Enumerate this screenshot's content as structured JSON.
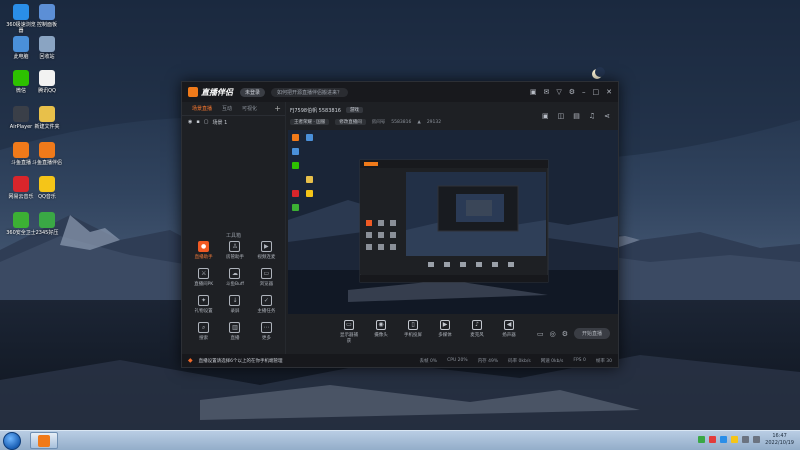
{
  "desktop": {
    "icons": [
      {
        "label": "360极速浏览器",
        "icon": "browser-360-icon",
        "color": "#2a8ee8"
      },
      {
        "label": "此电脑",
        "icon": "computer-icon",
        "color": "#4a90d9"
      },
      {
        "label": "微信",
        "icon": "wechat-icon",
        "color": "#2dc100"
      },
      {
        "label": "AirPlayer",
        "icon": "airplayer-icon",
        "color": "#3a3f48"
      },
      {
        "label": "斗鱼直播",
        "icon": "douyu-icon",
        "color": "#f07a1a"
      },
      {
        "label": "网易云音乐",
        "icon": "netease-music-icon",
        "color": "#d9252b"
      },
      {
        "label": "360安全卫士",
        "icon": "security-360-icon",
        "color": "#3cb034"
      },
      {
        "label": "控制面板",
        "icon": "control-panel-icon",
        "color": "#5c8fd6"
      },
      {
        "label": "回收站",
        "icon": "recycle-bin-icon",
        "color": "#8aa4c2"
      },
      {
        "label": "腾讯QQ",
        "icon": "qq-icon",
        "color": "#f2f2f2"
      },
      {
        "label": "新建文件夹",
        "icon": "folder-icon",
        "color": "#e8c04a"
      },
      {
        "label": "斗鱼直播伴侣",
        "icon": "douyu-companion-icon",
        "color": "#f07a1a"
      },
      {
        "label": "QQ音乐",
        "icon": "qq-music-icon",
        "color": "#f5c518"
      },
      {
        "label": "2345好压",
        "icon": "haozip-icon",
        "color": "#3aa845"
      }
    ]
  },
  "app": {
    "title": "直播伴侣",
    "login_badge": "未登录",
    "notice": "如何把开源直播伴侣搬进来？",
    "left_tabs": [
      "场景直播",
      "互动",
      "可视化"
    ],
    "scene_name": "场景 1",
    "tools_title": "工具箱",
    "tools": [
      {
        "label": "直播助手",
        "icon": "camera-icon",
        "hot": true
      },
      {
        "label": "房管助手",
        "icon": "user-icon",
        "hot": false
      },
      {
        "label": "视频连麦",
        "icon": "video-call-icon",
        "hot": false
      },
      {
        "label": "直播间PK",
        "icon": "pk-icon",
        "hot": false
      },
      {
        "label": "斗鱼Buff",
        "icon": "buff-icon",
        "hot": false
      },
      {
        "label": "浏览器",
        "icon": "browser-icon",
        "hot": false
      },
      {
        "label": "礼物设置",
        "icon": "gift-icon",
        "hot": false
      },
      {
        "label": "录屏",
        "icon": "download-icon",
        "hot": false
      },
      {
        "label": "主播任务",
        "icon": "task-icon",
        "hot": false
      },
      {
        "label": "搜索",
        "icon": "search-icon",
        "hot": false
      },
      {
        "label": "直播",
        "icon": "chart-icon",
        "hot": false
      },
      {
        "label": "更多",
        "icon": "more-icon",
        "hot": false
      }
    ],
    "room": {
      "title": "FJ7598伯帆 5583816",
      "tag": "游戏"
    },
    "meta": {
      "category": "王者荣耀 · 国服",
      "modify": "修改直播间",
      "room_label": "房间号",
      "room_id": "5583816",
      "hot": "29132"
    },
    "bottom_tools": [
      {
        "label": "显示器捕获",
        "icon": "monitor-icon"
      },
      {
        "label": "摄像头",
        "icon": "webcam-icon"
      },
      {
        "label": "手机投屏",
        "icon": "phone-cast-icon"
      },
      {
        "label": "多媒体",
        "icon": "media-icon"
      },
      {
        "label": "麦克风",
        "icon": "mic-icon"
      },
      {
        "label": "扬声器",
        "icon": "speaker-icon"
      }
    ],
    "start_button": "开始直播",
    "status": {
      "tip": "直播设置请选择6个以上的在你手机端管理",
      "stats": [
        "丢帧 0%",
        "CPU 20%",
        "内存 49%",
        "码率 0kb/s",
        "网速 0kb/s",
        "FPS 0",
        "帧率 30"
      ]
    }
  },
  "taskbar": {
    "time": "16:47",
    "date": "2022/10/19",
    "tray_colors": [
      "#3aa845",
      "#e23b3b",
      "#2a8ee8",
      "#f5c518",
      "#6b7380",
      "#6b7380"
    ]
  }
}
